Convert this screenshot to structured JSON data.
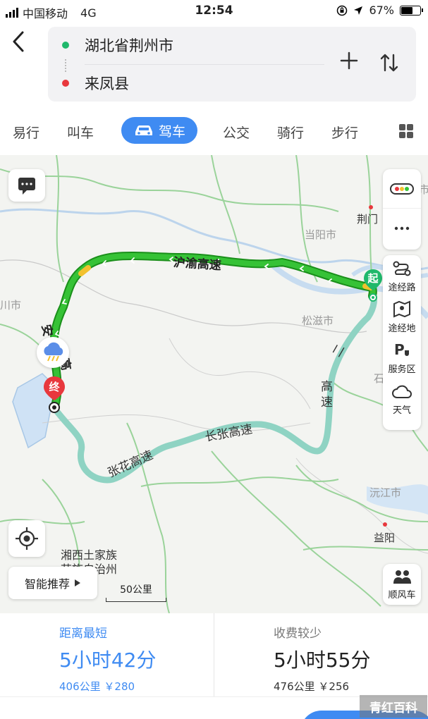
{
  "status_bar": {
    "carrier": "中国移动",
    "network": "4G",
    "time": "12:54",
    "battery_percent": "67%",
    "battery_level": 0.67
  },
  "route": {
    "origin": "湖北省荆州市",
    "destination": "来凤县",
    "origin_color": "#1fb86b",
    "destination_color": "#e8383d"
  },
  "tabs": [
    {
      "label": "易行"
    },
    {
      "label": "叫车"
    },
    {
      "label": "驾车",
      "active": true
    },
    {
      "label": "公交"
    },
    {
      "label": "骑行"
    },
    {
      "label": "步行"
    }
  ],
  "map": {
    "place_labels": {
      "jingmen": "荆门",
      "dangyang": "当阳市",
      "songzi": "松滋市",
      "yuanjiang": "沅江市",
      "yiyang": "益阳",
      "xiangxi_1": "湘西土家族",
      "xiangxi_2": "苗族自治州",
      "left_edge": "川市",
      "right_edge_1": "市",
      "right_edge_2": "石"
    },
    "road_labels": {
      "hu_yu": "沪渝高速",
      "an": "安",
      "lai": "高",
      "zhang_hua": "张花高速",
      "chang_zhang": "长张高速",
      "er_guang_1": "二",
      "er_guang_2": "高",
      "er_guang_3": "速"
    },
    "start_marker": "起",
    "end_marker": "终",
    "scale_label": "50公里",
    "smart_recommend": "智能推荐",
    "side_tools": [
      {
        "label": "途经路",
        "icon": "route-via-icon"
      },
      {
        "label": "途经地",
        "icon": "map-pin-icon"
      },
      {
        "label": "服务区",
        "icon": "parking-icon"
      },
      {
        "label": "天气",
        "icon": "cloud-icon"
      }
    ],
    "carpool_label": "顺风车",
    "route_color": "#2eb82e",
    "alt_route_color": "#8fd3c3"
  },
  "options": [
    {
      "tag": "距离最短",
      "duration": "5小时42分",
      "meta": "406公里 ￥280",
      "active": true
    },
    {
      "tag": "收费较少",
      "duration": "5小时55分",
      "meta": "476公里 ￥256",
      "active": false
    }
  ],
  "watermark": "青红百科"
}
